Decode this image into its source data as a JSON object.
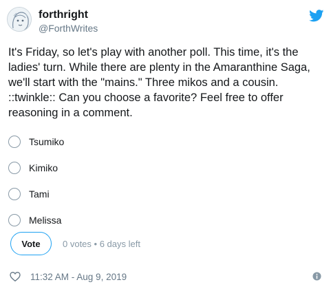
{
  "author": {
    "display_name": "forthright",
    "handle": "@ForthWrites",
    "avatar_icon": "avatar-sketch",
    "brand_icon": "twitter-bird-icon"
  },
  "tweet": {
    "text": "It's Friday, so let's play with another poll. This time, it's the ladies' turn. While there are plenty in the Amaranthine Saga, we'll start with the \"mains.\" Three mikos and a cousin. ::twinkle:: Can you choose a favorite? Feel free to offer reasoning in a comment."
  },
  "poll": {
    "options": [
      {
        "label": "Tsumiko"
      },
      {
        "label": "Kimiko"
      },
      {
        "label": "Tami"
      },
      {
        "label": "Melissa"
      }
    ],
    "vote_label": "Vote",
    "meta": "0 votes • 6 days left"
  },
  "footer": {
    "timestamp": "11:32 AM - Aug 9, 2019",
    "like_icon": "heart-icon",
    "info_icon": "info-icon"
  },
  "colors": {
    "accent": "#1da1f2",
    "text": "#14171a",
    "muted": "#657786"
  }
}
